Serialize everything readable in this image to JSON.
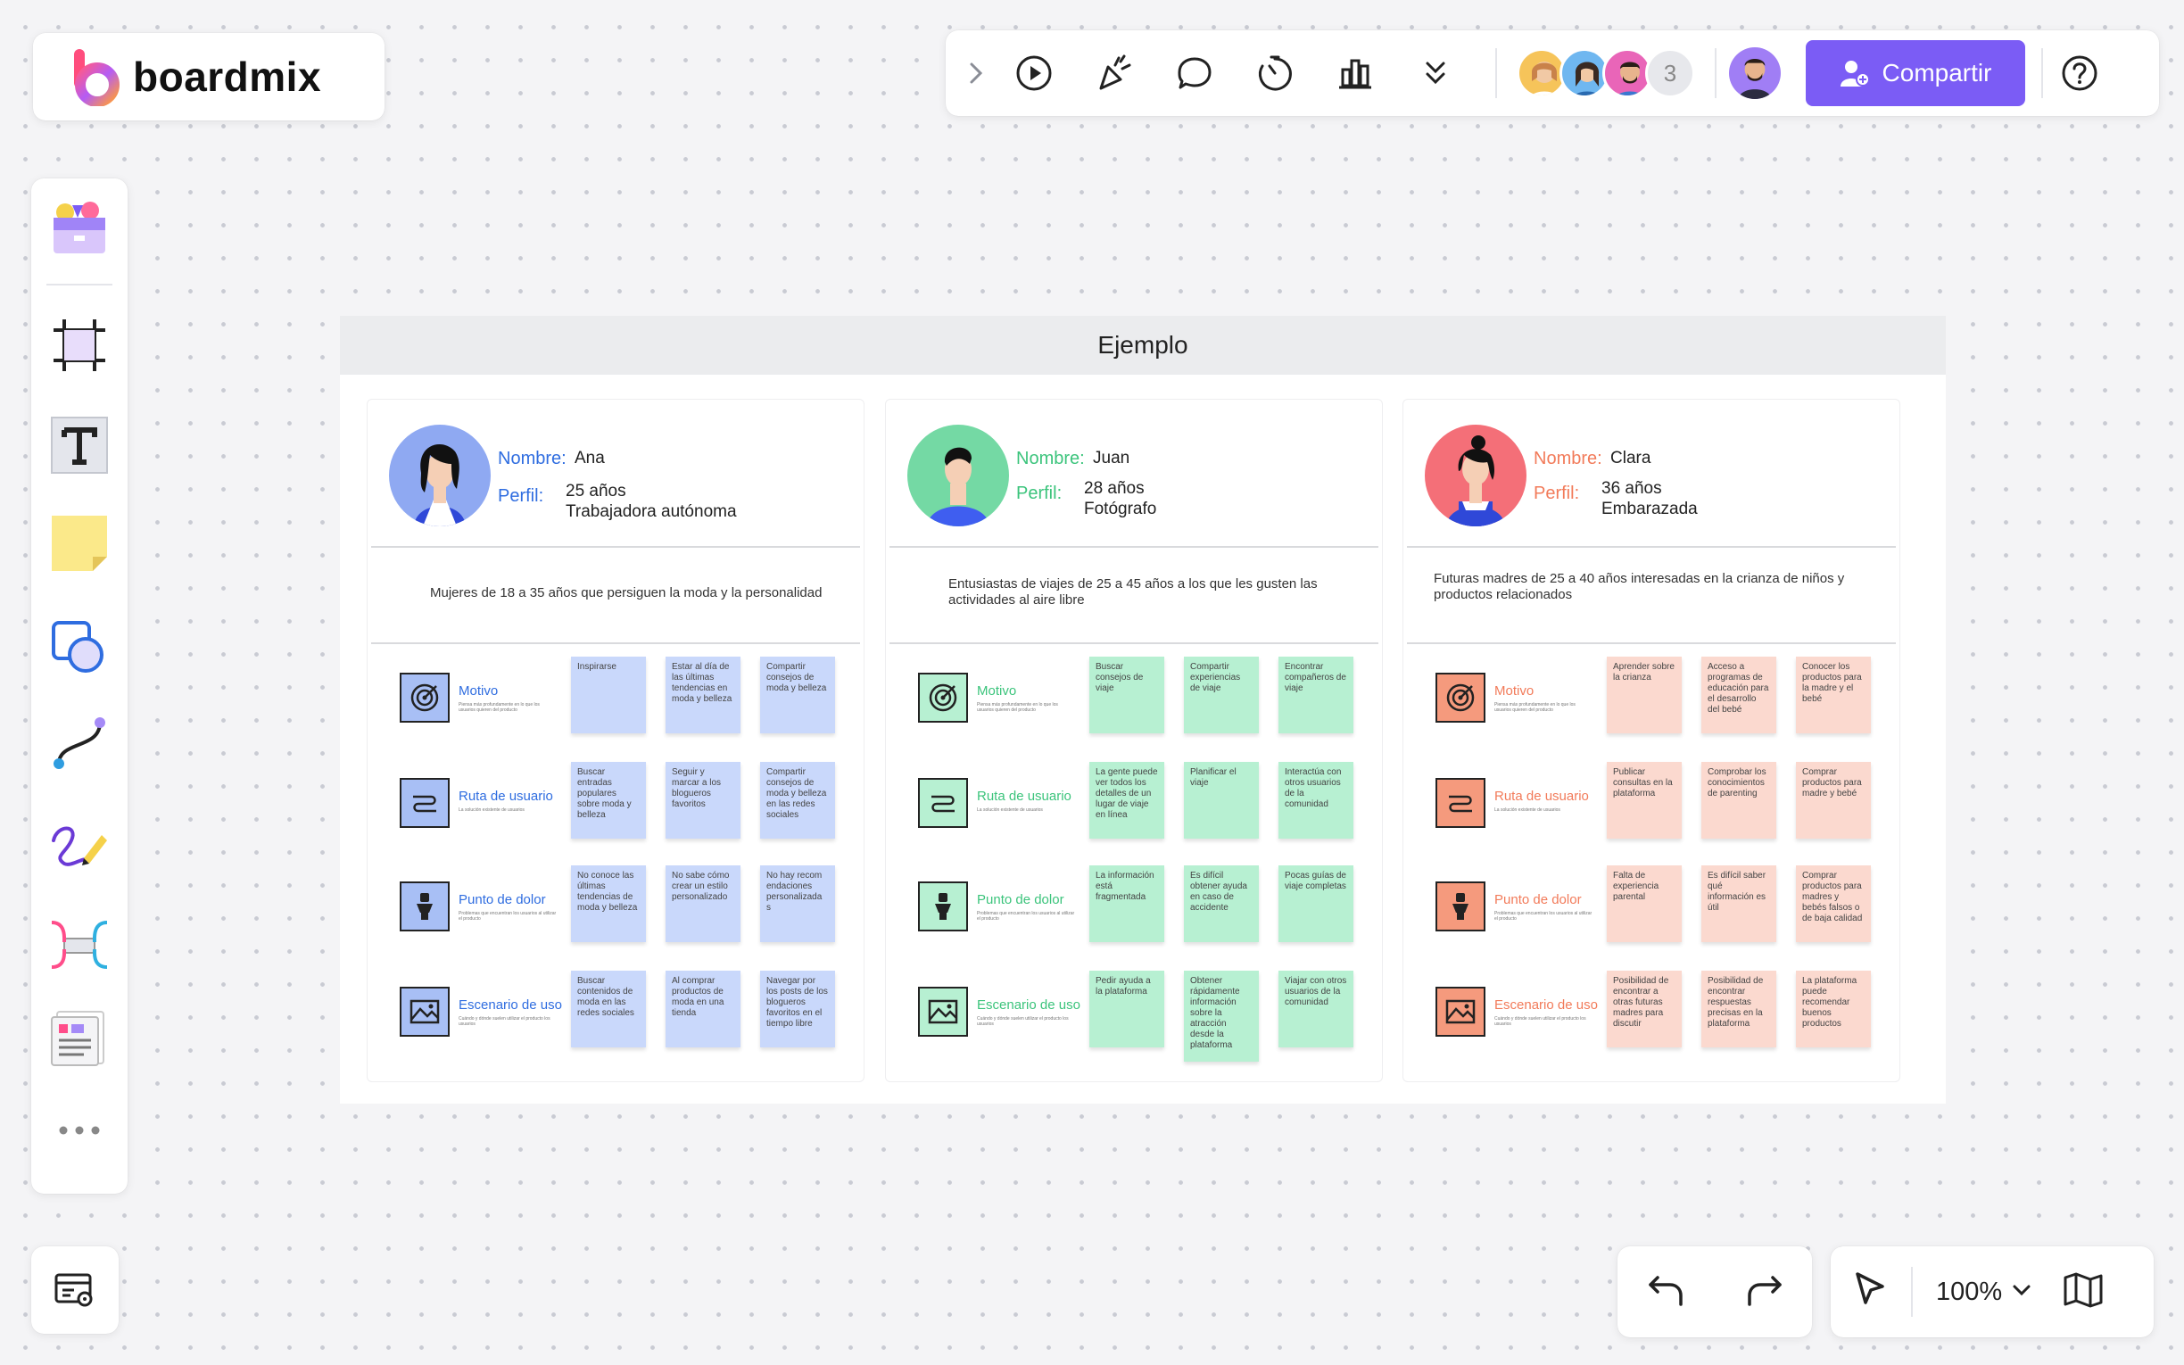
{
  "app": {
    "name": "boardmix"
  },
  "toolbar": {
    "collaborators_extra": "3",
    "share_label": "Compartir",
    "icons": [
      "chevron-right-icon",
      "play-icon",
      "celebrate-icon",
      "comment-icon",
      "timer-icon",
      "chart-icon",
      "more-down-icon",
      "help-icon"
    ]
  },
  "zoom": {
    "level": "100%"
  },
  "board": {
    "title": "Ejemplo",
    "labels": {
      "name": "Nombre:",
      "profile": "Perfil:",
      "rows": [
        "Motivo",
        "Ruta de usuario",
        "Punto de dolor",
        "Escenario de uso"
      ],
      "row_subs": [
        "Piensa más profundamente en lo que los usuarios quieren del producto",
        "La solución existente de usuarios",
        "Problemas que encuentran los usuarios al utilizar el producto",
        "Cuándo y dónde suelen utilizar el producto los usuarios"
      ]
    },
    "personas": [
      {
        "name": "Ana",
        "profile_line1": "25 años",
        "profile_line2": "Trabajadora autónoma",
        "description": "Mujeres de 18 a 35 años que persiguen la moda y la personalidad",
        "accent": "#2f6de0",
        "note_color": "#c9d8fb",
        "icon_bg": "#a8bff5",
        "notes": [
          [
            "Inspirarse",
            "Estar al día de las últimas tendencias en moda y belleza",
            "Compartir consejos de moda y belleza"
          ],
          [
            "Buscar entradas populares sobre moda y belleza",
            "Seguir y marcar a los blogueros favoritos",
            "Compartir consejos de moda y belleza en las redes sociales"
          ],
          [
            "No conoce las últimas tendencias de moda y belleza",
            "No sabe cómo crear un estilo personalizado",
            "No hay recom endaciones personalizada s"
          ],
          [
            "Buscar contenidos de moda en las redes sociales",
            "Al comprar productos de moda en una tienda",
            "Navegar por los posts de los blogueros favoritos en el tiempo libre"
          ]
        ]
      },
      {
        "name": "Juan",
        "profile_line1": "28 años",
        "profile_line2": "Fotógrafo",
        "description": "Entusiastas de viajes de 25 a 45 años a los que les gusten las actividades al aire libre",
        "accent": "#3cc47c",
        "note_color": "#b7f0d2",
        "icon_bg": "#b7f0d2",
        "notes": [
          [
            "Buscar consejos de viaje",
            "Compartir experiencias de viaje",
            "Encontrar compañeros de viaje"
          ],
          [
            "La gente puede ver todos los detalles de un lugar de viaje en línea",
            "Planificar el viaje",
            "Interactúa con otros usuarios de la comunidad"
          ],
          [
            "La información está fragmentada",
            "Es difícil obtener ayuda en caso de accidente",
            "Pocas guías de viaje completas"
          ],
          [
            "Pedir ayuda a la plataforma",
            "Obtener rápidamente información sobre la atracción desde la plataforma",
            "Viajar con otros usuarios de la comunidad"
          ]
        ]
      },
      {
        "name": "Clara",
        "profile_line1": "36 años",
        "profile_line2": "Embarazada",
        "description": "Futuras madres de 25 a 40 años interesadas en la crianza de niños y productos relacionados",
        "accent": "#f27b5a",
        "note_color": "#fbd9cf",
        "icon_bg": "#f59a7d",
        "notes": [
          [
            "Aprender sobre la crianza",
            "Acceso a programas de educación para el desarrollo del bebé",
            "Conocer los productos para la madre y el bebé"
          ],
          [
            "Publicar consultas en la plataforma",
            "Comprobar los conocimientos de parenting",
            "Comprar productos para madre y bebé"
          ],
          [
            "Falta de experiencia parental",
            "Es difícil saber qué información es útil",
            "Comprar productos para madres y bebés falsos o de baja calidad"
          ],
          [
            "Posibilidad de encontrar a otras futuras madres para discutir",
            "Posibilidad de encontrar respuestas precisas en la plataforma",
            "La plataforma puede recomendar buenos productos"
          ]
        ]
      }
    ]
  }
}
